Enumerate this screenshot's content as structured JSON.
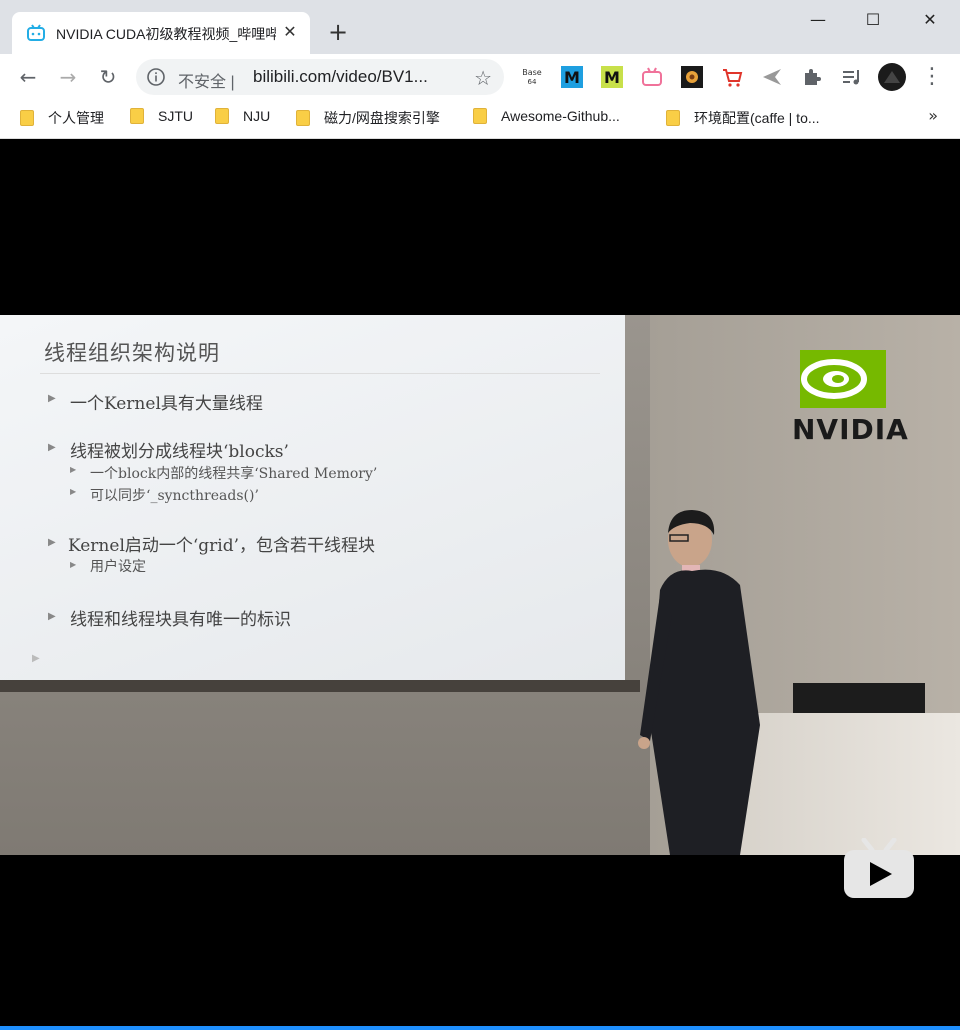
{
  "browser": {
    "tab": {
      "title": "NVIDIA CUDA初级教程视频_哔哩哔哩",
      "close": "✕"
    },
    "new_tab": "+",
    "window_controls": {
      "minimize": "—",
      "maximize": "☐",
      "close": "✕"
    },
    "toolbar": {
      "back": "←",
      "forward": "→",
      "reload": "↻",
      "security_label": "不安全 |",
      "url": "bilibili.com/video/BV1...",
      "star": "☆",
      "menu": "⋮"
    },
    "extensions": [
      {
        "name": "base64-icon",
        "label": "Base 64"
      },
      {
        "name": "m-blue-icon",
        "label": "M"
      },
      {
        "name": "m-green-icon",
        "label": "M"
      },
      {
        "name": "tv-pink-icon",
        "label": ""
      },
      {
        "name": "flower-icon",
        "label": ""
      },
      {
        "name": "cart-icon",
        "label": ""
      },
      {
        "name": "bird-icon",
        "label": ""
      },
      {
        "name": "puzzle-icon",
        "label": ""
      },
      {
        "name": "playlist-icon",
        "label": ""
      },
      {
        "name": "avatar-icon",
        "label": ""
      }
    ],
    "bookmarks": [
      {
        "label": "个人管理"
      },
      {
        "label": "SJTU"
      },
      {
        "label": "NJU"
      },
      {
        "label": "磁力/网盘搜索引擎"
      },
      {
        "label": "Awesome-Github..."
      },
      {
        "label": "环境配置(caffe | to..."
      }
    ],
    "bookmarks_more": "»"
  },
  "slide": {
    "title": "线程组织架构说明",
    "bullets": [
      {
        "text": "一个Kernel具有大量线程",
        "level": 1
      },
      {
        "text": "线程被划分成线程块‘blocks’",
        "level": 1
      },
      {
        "text": "一个block内部的线程共享‘Shared Memory’",
        "level": 2
      },
      {
        "text": "可以同步‘_syncthreads()’",
        "level": 2
      },
      {
        "text": "Kernel启动一个‘grid’，包含若干线程块",
        "level": 1
      },
      {
        "text": "用户设定",
        "level": 2
      },
      {
        "text": "线程和线程块具有唯一的标识",
        "level": 1
      }
    ]
  },
  "brand": {
    "logo_text": "NVIDIA",
    "accent": "#76b900"
  },
  "colors": {
    "progress": "#1e90ff",
    "tab_accent": "#23ade5"
  }
}
